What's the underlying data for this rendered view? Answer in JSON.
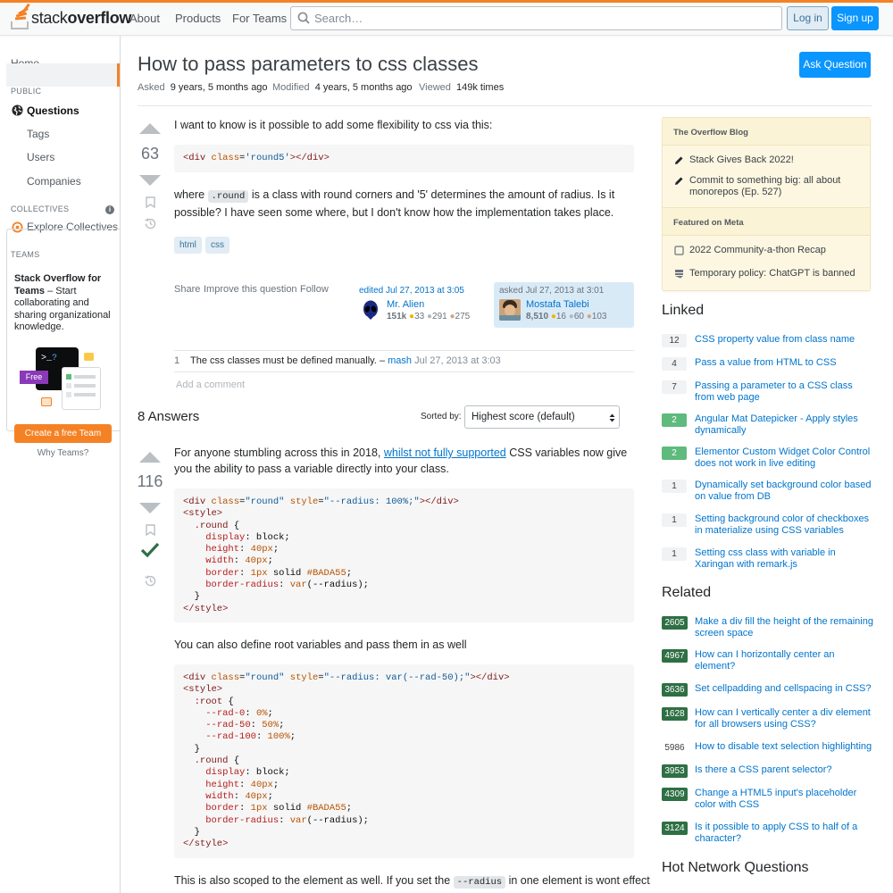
{
  "header": {
    "logo_light": "stack",
    "logo_bold": "overflow",
    "nav": [
      "About",
      "Products",
      "For Teams"
    ],
    "search_placeholder": "Search…",
    "login": "Log in",
    "signup": "Sign up"
  },
  "leftnav": {
    "home": "Home",
    "public_heading": "PUBLIC",
    "questions": "Questions",
    "tags": "Tags",
    "users": "Users",
    "companies": "Companies",
    "collectives_heading": "COLLECTIVES",
    "explore_collectives": "Explore Collectives",
    "teams_heading": "TEAMS",
    "teams_title": "Stack Overflow for Teams",
    "teams_desc": "– Start collaborating and sharing organizational knowledge.",
    "teams_free": "Free",
    "create_team": "Create a free Team",
    "why_teams": "Why Teams?"
  },
  "question": {
    "title": "How to pass parameters to css classes",
    "asked_label": "Asked",
    "asked_value": "9 years, 5 months ago",
    "modified_label": "Modified",
    "modified_value": "4 years, 5 months ago",
    "viewed_label": "Viewed",
    "viewed_value": "149k times",
    "ask_button": "Ask Question",
    "votes": "63",
    "text1": "I want to know is it possible to add some flexibility to css via this:",
    "code1": "<div class='round5'></div>",
    "text2_a": "where ",
    "text2_code": ".round",
    "text2_b": " is a class with round corners and '5' determines the amount of radius. Is it possible? I have seen some where, but I don't know how the implementation takes place.",
    "tags": [
      "html",
      "css"
    ],
    "menu": [
      "Share",
      "Improve this question",
      "Follow"
    ],
    "edited": "edited Jul 27, 2013 at 3:05",
    "editor_name": "Mr. Alien",
    "editor_rep": "151k",
    "editor_gold": "33",
    "editor_silver": "291",
    "editor_bronze": "275",
    "asked_card": "asked Jul 27, 2013 at 3:01",
    "asker_name": "Mostafa Talebi",
    "asker_rep": "8,510",
    "asker_gold": "16",
    "asker_silver": "60",
    "asker_bronze": "103",
    "comment_score": "1",
    "comment_text": "The css classes must be defined manually. –",
    "comment_user": "mash",
    "comment_date": "Jul 27, 2013 at 3:03",
    "add_comment": "Add a comment"
  },
  "answers": {
    "count_label": "8 Answers",
    "sorted_by": "Sorted by:",
    "sort_value": "Highest score (default)",
    "votes": "116",
    "text1_a": "For anyone stumbling across this in 2018, ",
    "text1_link": "whilst not fully supported",
    "text1_b": " CSS variables now give you the ability to pass a variable directly into your class.",
    "text2": "You can also define root variables and pass them in as well",
    "text3_a": "This is also scoped to the element as well. If you set the ",
    "text3_code": "--radius",
    "text3_b": " in one element is wont effect"
  },
  "sidebar": {
    "blog_heading": "The Overflow Blog",
    "blog_items": [
      "Stack Gives Back 2022!",
      "Commit to something big: all about monorepos (Ep. 527)"
    ],
    "meta_heading": "Featured on Meta",
    "meta_items": [
      "2022 Community-a-thon Recap",
      "Temporary policy: ChatGPT is banned"
    ],
    "linked_heading": "Linked",
    "linked": [
      {
        "count": "12",
        "title": "CSS property value from class name"
      },
      {
        "count": "4",
        "title": "Pass a value from HTML to CSS"
      },
      {
        "count": "7",
        "title": "Passing a parameter to a CSS class from web page"
      },
      {
        "count": "2",
        "title": "Angular Mat Datepicker - Apply styles dynamically"
      },
      {
        "count": "2",
        "title": "Elementor Custom Widget Color Control does not work in live editing"
      },
      {
        "count": "1",
        "title": "Dynamically set background color based on value from DB"
      },
      {
        "count": "1",
        "title": "Setting background color of checkboxes in materialize using CSS variables"
      },
      {
        "count": "1",
        "title": "Setting css class with variable in Xaringan with remark.js"
      }
    ],
    "related_heading": "Related",
    "related": [
      {
        "count": "2605",
        "title": "Make a div fill the height of the remaining screen space"
      },
      {
        "count": "4967",
        "title": "How can I horizontally center an element?"
      },
      {
        "count": "3636",
        "title": "Set cellpadding and cellspacing in CSS?"
      },
      {
        "count": "1628",
        "title": "How can I vertically center a div element for all browsers using CSS?"
      },
      {
        "count": "5986",
        "title": "How to disable text selection highlighting"
      },
      {
        "count": "3953",
        "title": "Is there a CSS parent selector?"
      },
      {
        "count": "4309",
        "title": "Change a HTML5 input's placeholder color with CSS"
      },
      {
        "count": "3124",
        "title": "Is it possible to apply CSS to half of a character?"
      }
    ],
    "hot_heading": "Hot Network Questions"
  }
}
